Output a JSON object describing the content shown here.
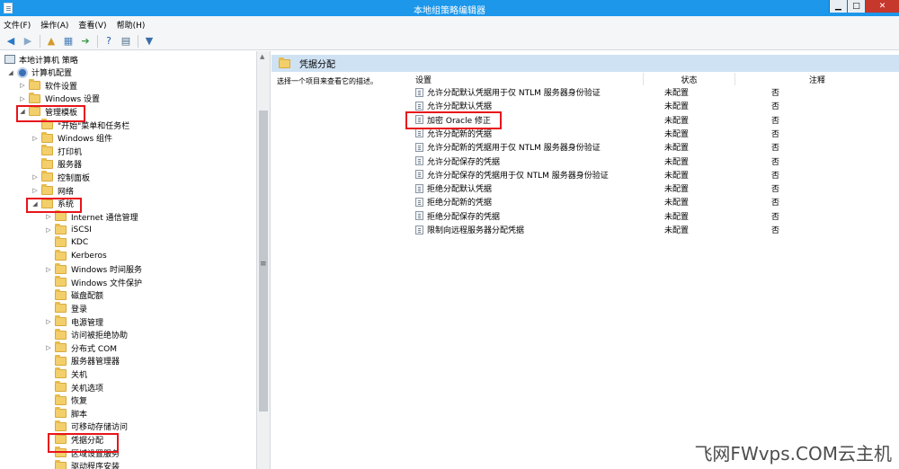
{
  "window": {
    "title": "本地组策略编辑器",
    "controls": {
      "minimize": "▁",
      "maximize": "□",
      "close": "✕"
    }
  },
  "menubar": [
    "文件(F)",
    "操作(A)",
    "查看(V)",
    "帮助(H)"
  ],
  "toolbar": [
    "back-arrow-icon",
    "forward-arrow-icon",
    "up-folder-icon",
    "show-hide-tree-icon",
    "export-list-icon",
    "help-icon",
    "properties-icon",
    "filter-icon"
  ],
  "tree": [
    {
      "label": "本地计算机 策略",
      "level": 0,
      "expander": "",
      "icon": "computer-icon"
    },
    {
      "label": "计算机配置",
      "level": 1,
      "expander": "◢",
      "icon": "gear-icon"
    },
    {
      "label": "软件设置",
      "level": 2,
      "expander": "▷",
      "icon": "folder-icon"
    },
    {
      "label": "Windows 设置",
      "level": 2,
      "expander": "▷",
      "icon": "folder-icon"
    },
    {
      "label": "管理模板",
      "level": 2,
      "expander": "◢",
      "icon": "folder-icon"
    },
    {
      "label": "\"开始\"菜单和任务栏",
      "level": 3,
      "expander": "",
      "icon": "folder-icon"
    },
    {
      "label": "Windows 组件",
      "level": 3,
      "expander": "▷",
      "icon": "folder-icon"
    },
    {
      "label": "打印机",
      "level": 3,
      "expander": "",
      "icon": "folder-icon"
    },
    {
      "label": "服务器",
      "level": 3,
      "expander": "",
      "icon": "folder-icon"
    },
    {
      "label": "控制面板",
      "level": 3,
      "expander": "▷",
      "icon": "folder-icon"
    },
    {
      "label": "网络",
      "level": 3,
      "expander": "▷",
      "icon": "folder-icon"
    },
    {
      "label": "系统",
      "level": 3,
      "expander": "◢",
      "icon": "folder-icon"
    },
    {
      "label": "Internet 通信管理",
      "level": 4,
      "expander": "▷",
      "icon": "folder-icon"
    },
    {
      "label": "iSCSI",
      "level": 4,
      "expander": "▷",
      "icon": "folder-icon"
    },
    {
      "label": "KDC",
      "level": 4,
      "expander": "",
      "icon": "folder-icon"
    },
    {
      "label": "Kerberos",
      "level": 4,
      "expander": "",
      "icon": "folder-icon"
    },
    {
      "label": "Windows 时间服务",
      "level": 4,
      "expander": "▷",
      "icon": "folder-icon"
    },
    {
      "label": "Windows 文件保护",
      "level": 4,
      "expander": "",
      "icon": "folder-icon"
    },
    {
      "label": "磁盘配额",
      "level": 4,
      "expander": "",
      "icon": "folder-icon"
    },
    {
      "label": "登录",
      "level": 4,
      "expander": "",
      "icon": "folder-icon"
    },
    {
      "label": "电源管理",
      "level": 4,
      "expander": "▷",
      "icon": "folder-icon"
    },
    {
      "label": "访问被拒绝协助",
      "level": 4,
      "expander": "",
      "icon": "folder-icon"
    },
    {
      "label": "分布式 COM",
      "level": 4,
      "expander": "▷",
      "icon": "folder-icon"
    },
    {
      "label": "服务器管理器",
      "level": 4,
      "expander": "",
      "icon": "folder-icon"
    },
    {
      "label": "关机",
      "level": 4,
      "expander": "",
      "icon": "folder-icon"
    },
    {
      "label": "关机选项",
      "level": 4,
      "expander": "",
      "icon": "folder-icon"
    },
    {
      "label": "恢复",
      "level": 4,
      "expander": "",
      "icon": "folder-icon"
    },
    {
      "label": "脚本",
      "level": 4,
      "expander": "",
      "icon": "folder-icon"
    },
    {
      "label": "可移动存储访问",
      "level": 4,
      "expander": "",
      "icon": "folder-icon"
    },
    {
      "label": "凭据分配",
      "level": 4,
      "expander": "",
      "icon": "folder-icon"
    },
    {
      "label": "区域设置服务",
      "level": 4,
      "expander": "",
      "icon": "folder-icon"
    },
    {
      "label": "驱动程序安装",
      "level": 4,
      "expander": "",
      "icon": "folder-icon"
    }
  ],
  "right": {
    "header": "凭据分配",
    "description": "选择一个项目来查看它的描述。",
    "columns": {
      "setting": "设置",
      "state": "状态",
      "comment": "注释"
    },
    "rows": [
      {
        "name": "允许分配默认凭据用于仅 NTLM 服务器身份验证",
        "state": "未配置",
        "comment": "否"
      },
      {
        "name": "允许分配默认凭据",
        "state": "未配置",
        "comment": "否"
      },
      {
        "name": "加密 Oracle 修正",
        "state": "未配置",
        "comment": "否"
      },
      {
        "name": "允许分配新的凭据",
        "state": "未配置",
        "comment": "否"
      },
      {
        "name": "允许分配新的凭据用于仅 NTLM 服务器身份验证",
        "state": "未配置",
        "comment": "否"
      },
      {
        "name": "允许分配保存的凭据",
        "state": "未配置",
        "comment": "否"
      },
      {
        "name": "允许分配保存的凭据用于仅 NTLM 服务器身份验证",
        "state": "未配置",
        "comment": "否"
      },
      {
        "name": "拒绝分配默认凭据",
        "state": "未配置",
        "comment": "否"
      },
      {
        "name": "拒绝分配新的凭据",
        "state": "未配置",
        "comment": "否"
      },
      {
        "name": "拒绝分配保存的凭据",
        "state": "未配置",
        "comment": "否"
      },
      {
        "name": "限制向远程服务器分配凭据",
        "state": "未配置",
        "comment": "否"
      }
    ]
  },
  "watermark": "飞网FWvps.COM云主机",
  "colors": {
    "titlebar": "#1c97ea",
    "highlight_box": "#e8141a",
    "pane_header": "#cfe2f4"
  }
}
